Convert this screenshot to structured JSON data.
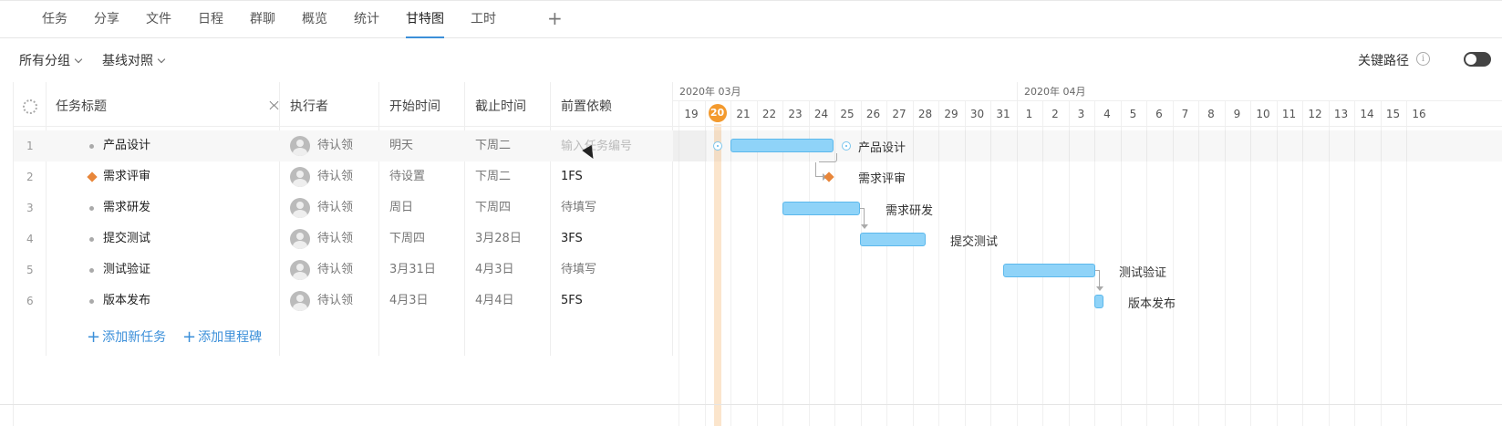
{
  "tabs": [
    "任务",
    "分享",
    "文件",
    "日程",
    "群聊",
    "概览",
    "统计",
    "甘特图",
    "工时"
  ],
  "active_tab": "甘特图",
  "toolbar": {
    "group_dropdown": "所有分组",
    "baseline_dropdown": "基线对照",
    "critical_path_label": "关键路径",
    "info_symbol": "i"
  },
  "columns": {
    "title": "任务标题",
    "assignee": "执行者",
    "start": "开始时间",
    "end": "截止时间",
    "dependency": "前置依赖"
  },
  "rows": [
    {
      "num": "1",
      "title": "产品设计",
      "assignee": "待认领",
      "start": "明天",
      "end": "下周二",
      "dependency": "",
      "dependency_placeholder": "输入任务编号"
    },
    {
      "num": "2",
      "title": "需求评审",
      "assignee": "待认领",
      "start": "待设置",
      "end": "下周二",
      "dependency": "1FS"
    },
    {
      "num": "3",
      "title": "需求研发",
      "assignee": "待认领",
      "start": "周日",
      "end": "下周四",
      "dependency": "待填写"
    },
    {
      "num": "4",
      "title": "提交测试",
      "assignee": "待认领",
      "start": "下周四",
      "end": "3月28日",
      "dependency": "3FS"
    },
    {
      "num": "5",
      "title": "测试验证",
      "assignee": "待认领",
      "start": "3月31日",
      "end": "4月3日",
      "dependency": "待填写"
    },
    {
      "num": "6",
      "title": "版本发布",
      "assignee": "待认领",
      "start": "4月3日",
      "end": "4月4日",
      "dependency": "5FS"
    }
  ],
  "actions": {
    "add_task": "添加新任务",
    "add_milestone": "添加里程碑",
    "plus_symbol": "+"
  },
  "gantt": {
    "months": [
      "2020年 03月",
      "2020年 04月"
    ],
    "days": [
      "19",
      "20",
      "21",
      "22",
      "23",
      "24",
      "25",
      "26",
      "27",
      "28",
      "29",
      "30",
      "31",
      "1",
      "2",
      "3",
      "4",
      "5",
      "6",
      "7",
      "8",
      "9",
      "10",
      "11",
      "12",
      "13",
      "14",
      "15",
      "16"
    ],
    "today": "20",
    "bar_labels": [
      "产品设计",
      "需求评审",
      "需求研发",
      "提交测试",
      "测试验证",
      "版本发布"
    ],
    "bar_color": "#8fd3f8",
    "milestone_color": "#e8863a",
    "today_color": "#f39a2e"
  }
}
